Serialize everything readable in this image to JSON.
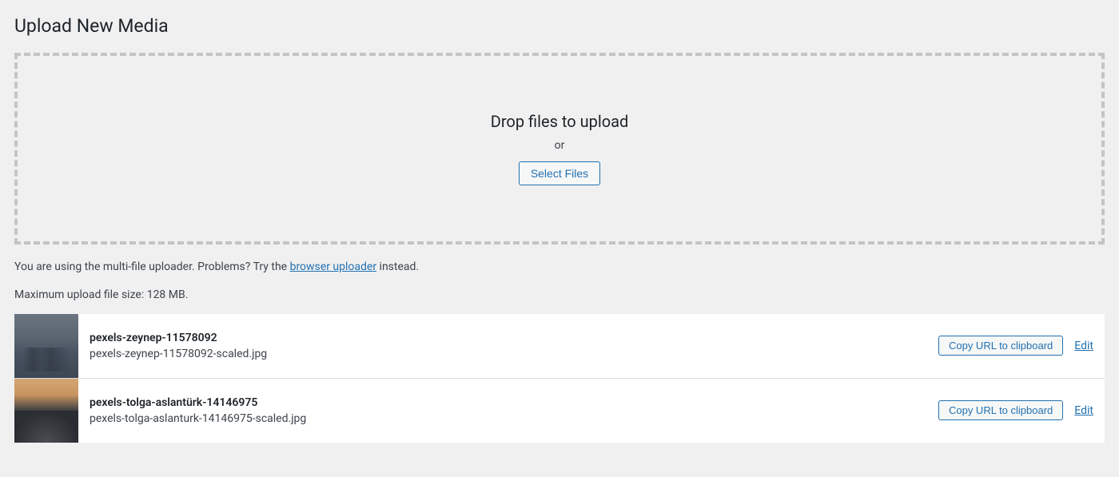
{
  "page": {
    "title": "Upload New Media"
  },
  "dropzone": {
    "title": "Drop files to upload",
    "or": "or",
    "button": "Select Files"
  },
  "help": {
    "prefix": "You are using the multi-file uploader. Problems? Try the ",
    "link": "browser uploader",
    "suffix": " instead."
  },
  "max_size": "Maximum upload file size: 128 MB.",
  "actions": {
    "copy_url": "Copy URL to clipboard",
    "edit": "Edit"
  },
  "media": [
    {
      "title": "pexels-zeynep-11578092",
      "filename": "pexels-zeynep-11578092-scaled.jpg"
    },
    {
      "title": "pexels-tolga-aslantürk-14146975",
      "filename": "pexels-tolga-aslanturk-14146975-scaled.jpg"
    }
  ]
}
